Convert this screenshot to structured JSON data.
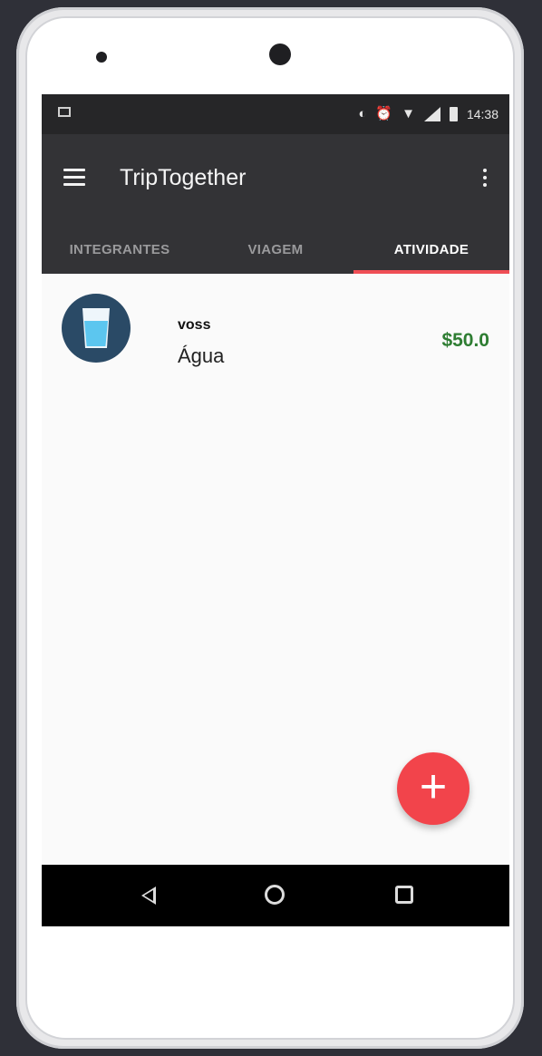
{
  "status_bar": {
    "time": "14:38",
    "icons": [
      "image-notification-icon",
      "vibrate-icon",
      "alarm-icon",
      "wifi-icon",
      "signal-icon",
      "battery-icon"
    ]
  },
  "app_bar": {
    "title": "TripTogether",
    "menu_icon": "hamburger-menu-icon",
    "overflow_icon": "more-vert-icon"
  },
  "tabs": [
    {
      "label": "INTEGRANTES",
      "active": false
    },
    {
      "label": "VIAGEM",
      "active": false
    },
    {
      "label": "ATIVIDADE",
      "active": true
    }
  ],
  "activities": [
    {
      "user": "voss",
      "description": "Água",
      "amount": "$50.0",
      "icon": "water-glass-icon"
    }
  ],
  "fab": {
    "icon": "add-icon",
    "label": "+"
  },
  "colors": {
    "app_bar": "#333336",
    "accent": "#ef4e55",
    "amount_green": "#2e7d32",
    "avatar_bg": "#2a4a66"
  }
}
